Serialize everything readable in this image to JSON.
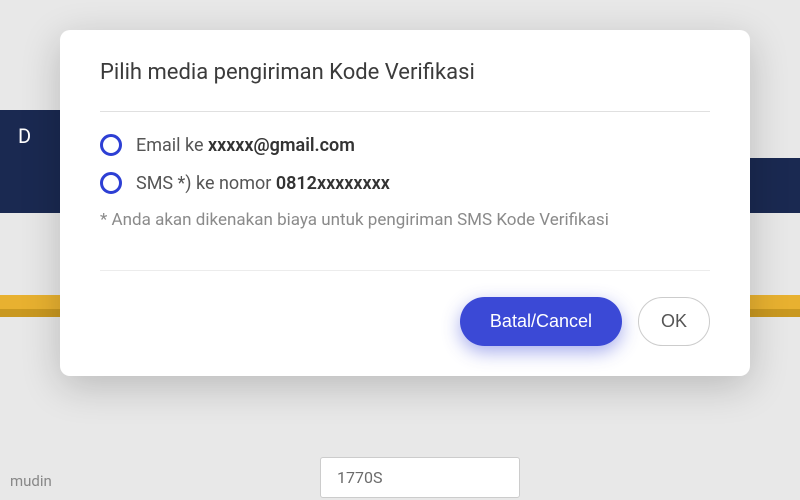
{
  "modal": {
    "title": "Pilih media pengiriman Kode Verifikasi",
    "options": [
      {
        "prefix": "Email ke ",
        "value": "xxxxx@gmail.com"
      },
      {
        "prefix": "SMS *) ke nomor ",
        "value": "0812xxxxxxxx"
      }
    ],
    "footnote": "* Anda akan dikenakan biaya untuk pengiriman SMS Kode Verifikasi",
    "buttons": {
      "cancel": "Batal/Cancel",
      "ok": "OK"
    }
  },
  "background": {
    "tab_letter": "D",
    "bottom_text": "mudin",
    "bottom_input_value": "1770S"
  }
}
